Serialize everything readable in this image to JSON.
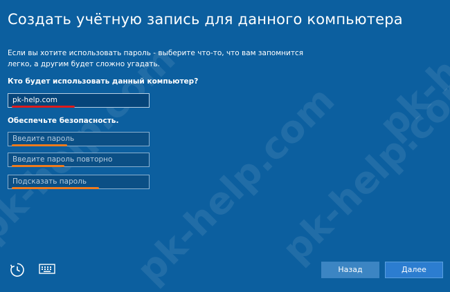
{
  "page": {
    "title": "Создать учётную запись для данного компьютера",
    "description": "Если вы хотите использовать пароль - выберите что-то, что вам запомнится легко, а другим будет сложно угадать."
  },
  "form": {
    "who_label": "Кто будет использовать данный компьютер?",
    "username_value": "pk-help.com",
    "security_label": "Обеспечьте безопасность.",
    "password_placeholder": "Введите пароль",
    "password_repeat_placeholder": "Введите пароль повторно",
    "hint_placeholder": "Подсказать пароль"
  },
  "buttons": {
    "back": "Назад",
    "next": "Далее"
  },
  "icons": {
    "accessibility": "accessibility-icon",
    "keyboard": "keyboard-icon"
  },
  "watermark": "pk-help.com",
  "colors": {
    "background": "#0c5f9f",
    "annotation_red": "#e01a1a",
    "annotation_orange": "#f07b1c"
  }
}
